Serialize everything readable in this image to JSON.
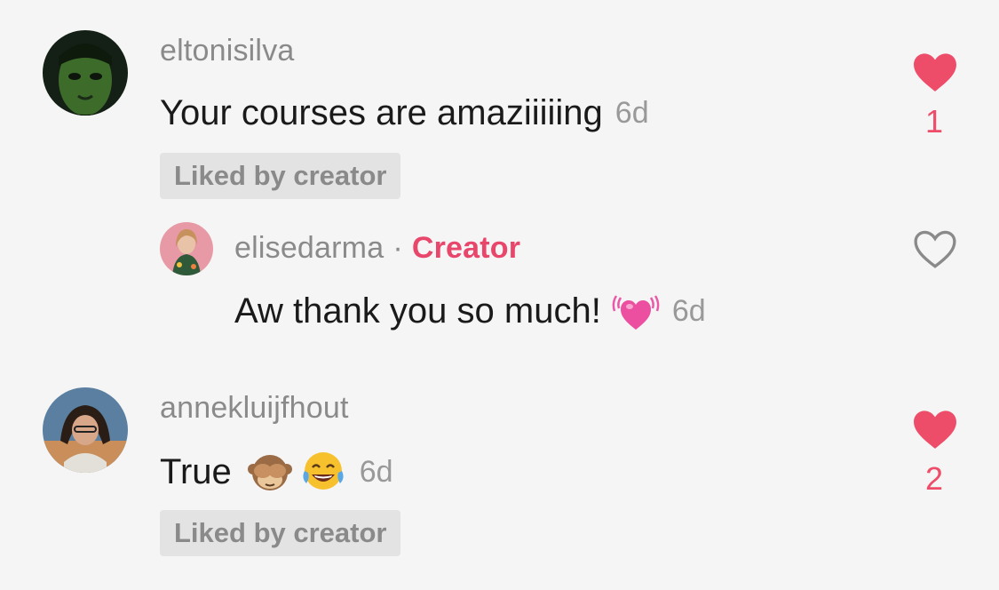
{
  "comments": [
    {
      "username": "eltonisilva",
      "text": "Your courses are amaziiiiing",
      "time": "6d",
      "badge": "Liked by creator",
      "likes": "1",
      "liked": true,
      "avatar_icon": "avatar-green-face",
      "reply": {
        "username": "elisedarma",
        "separator": "·",
        "role": "Creator",
        "text": "Aw thank you so much!",
        "emoji": "beating-heart-emoji",
        "time": "6d",
        "liked": false,
        "avatar_icon": "avatar-woman-green"
      }
    },
    {
      "username": "annekluijfhout",
      "text": "True",
      "emojis": [
        "see-no-evil-monkey-emoji",
        "tears-of-joy-emoji"
      ],
      "time": "6d",
      "badge": "Liked by creator",
      "likes": "2",
      "liked": true,
      "avatar_icon": "avatar-woman-dark-hair"
    }
  ],
  "colors": {
    "background": "#f5f5f5",
    "accent": "#ee4d6a",
    "creator": "#e8466b",
    "muted": "#8a8a8a",
    "badge_bg": "#e3e3e3"
  }
}
